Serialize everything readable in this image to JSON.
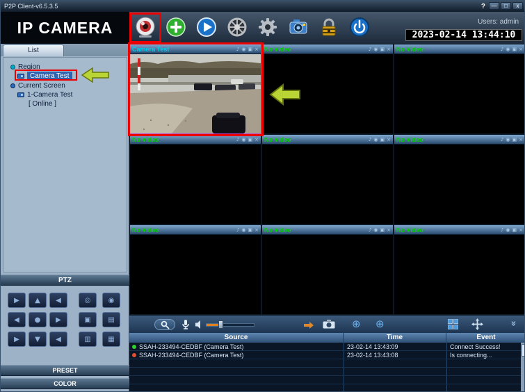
{
  "titlebar": {
    "title": "P2P Client-v6.5.3.5",
    "help": "?",
    "minimize": "—",
    "maximize": "□",
    "close": "x"
  },
  "header": {
    "logo": "IP CAMERA",
    "users": "Users: admin",
    "datetime": "2023-02-14 13:44:10"
  },
  "toolbar": {
    "icons": [
      "camera-preview",
      "add-device",
      "playback",
      "map",
      "settings",
      "device-config",
      "lock",
      "power"
    ]
  },
  "sidebar": {
    "tab": "List",
    "tree": {
      "region": "Region",
      "camera": "Camera Test",
      "current_screen": "Current Screen",
      "sub_camera": "1-Camera Test",
      "status": "[  Online  ]"
    },
    "ptz_label": "PTZ",
    "preset_label": "PRESET",
    "color_label": "COLOR",
    "ptz_pad": {
      "r1": [
        "▶",
        "▲",
        "◀",
        "◎",
        "◉"
      ],
      "r2": [
        "◀",
        "●",
        "▶",
        "▣",
        "▤"
      ],
      "r3": [
        "▶",
        "▼",
        "◀",
        "▥",
        "▦"
      ]
    }
  },
  "grid": {
    "cells": [
      {
        "title": "Camera Test"
      },
      {
        "title": "No Video"
      },
      {
        "title": "No Video"
      },
      {
        "title": "No Video"
      },
      {
        "title": "No Video"
      },
      {
        "title": "No Video"
      },
      {
        "title": "No Video"
      },
      {
        "title": "No Video"
      },
      {
        "title": "No Video"
      }
    ],
    "header_icons": [
      "♪",
      "◉",
      "▣",
      "×"
    ]
  },
  "bottombar": {
    "target_glyph": "⊕",
    "chevron": "»"
  },
  "events": {
    "headers": [
      "Source",
      "Time",
      "Event"
    ],
    "rows": [
      {
        "source": "SSAH-233494-CEDBF (Camera Test)",
        "time": "23-02-14 13:43:09",
        "event": "Connect Success!"
      },
      {
        "source": "SSAH-233494-CEDBF (Camera Test)",
        "time": "23-02-14 13:43:08",
        "event": "Is connecting..."
      }
    ]
  },
  "colors": {
    "annotation_red": "#ee0000",
    "arrow_green": "#b8d435",
    "no_video_green": "#00d400",
    "active_title_cyan": "#00d0f0",
    "success_dot": "#30d030",
    "connecting_dot": "#e05030"
  }
}
